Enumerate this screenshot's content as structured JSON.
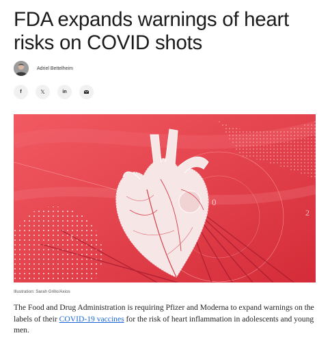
{
  "article": {
    "headline": "FDA expands warnings of heart risks on COVID shots",
    "author": "Adriel Bettelheim",
    "image_credit": "Illustration: Sarah Grillo/Axios",
    "lede_before": "The Food and Drug Administration is requiring Pfizer and Moderna to expand warnings on the labels of their ",
    "lede_link": "COVID-19 vaccines",
    "lede_after": " for the risk of heart inflammation in adolescents and young men."
  },
  "share": [
    {
      "name": "facebook",
      "label": "f"
    },
    {
      "name": "x",
      "label": "𝕏"
    },
    {
      "name": "linkedin",
      "label": "in"
    },
    {
      "name": "email",
      "label": "email"
    }
  ],
  "hero": {
    "background_color": "#ea3b44",
    "numbers": [
      "0",
      "2",
      "1"
    ]
  },
  "colors": {
    "text": "#1b1b1b",
    "link": "#1a66d6",
    "share_bg": "#f1f1f1"
  }
}
